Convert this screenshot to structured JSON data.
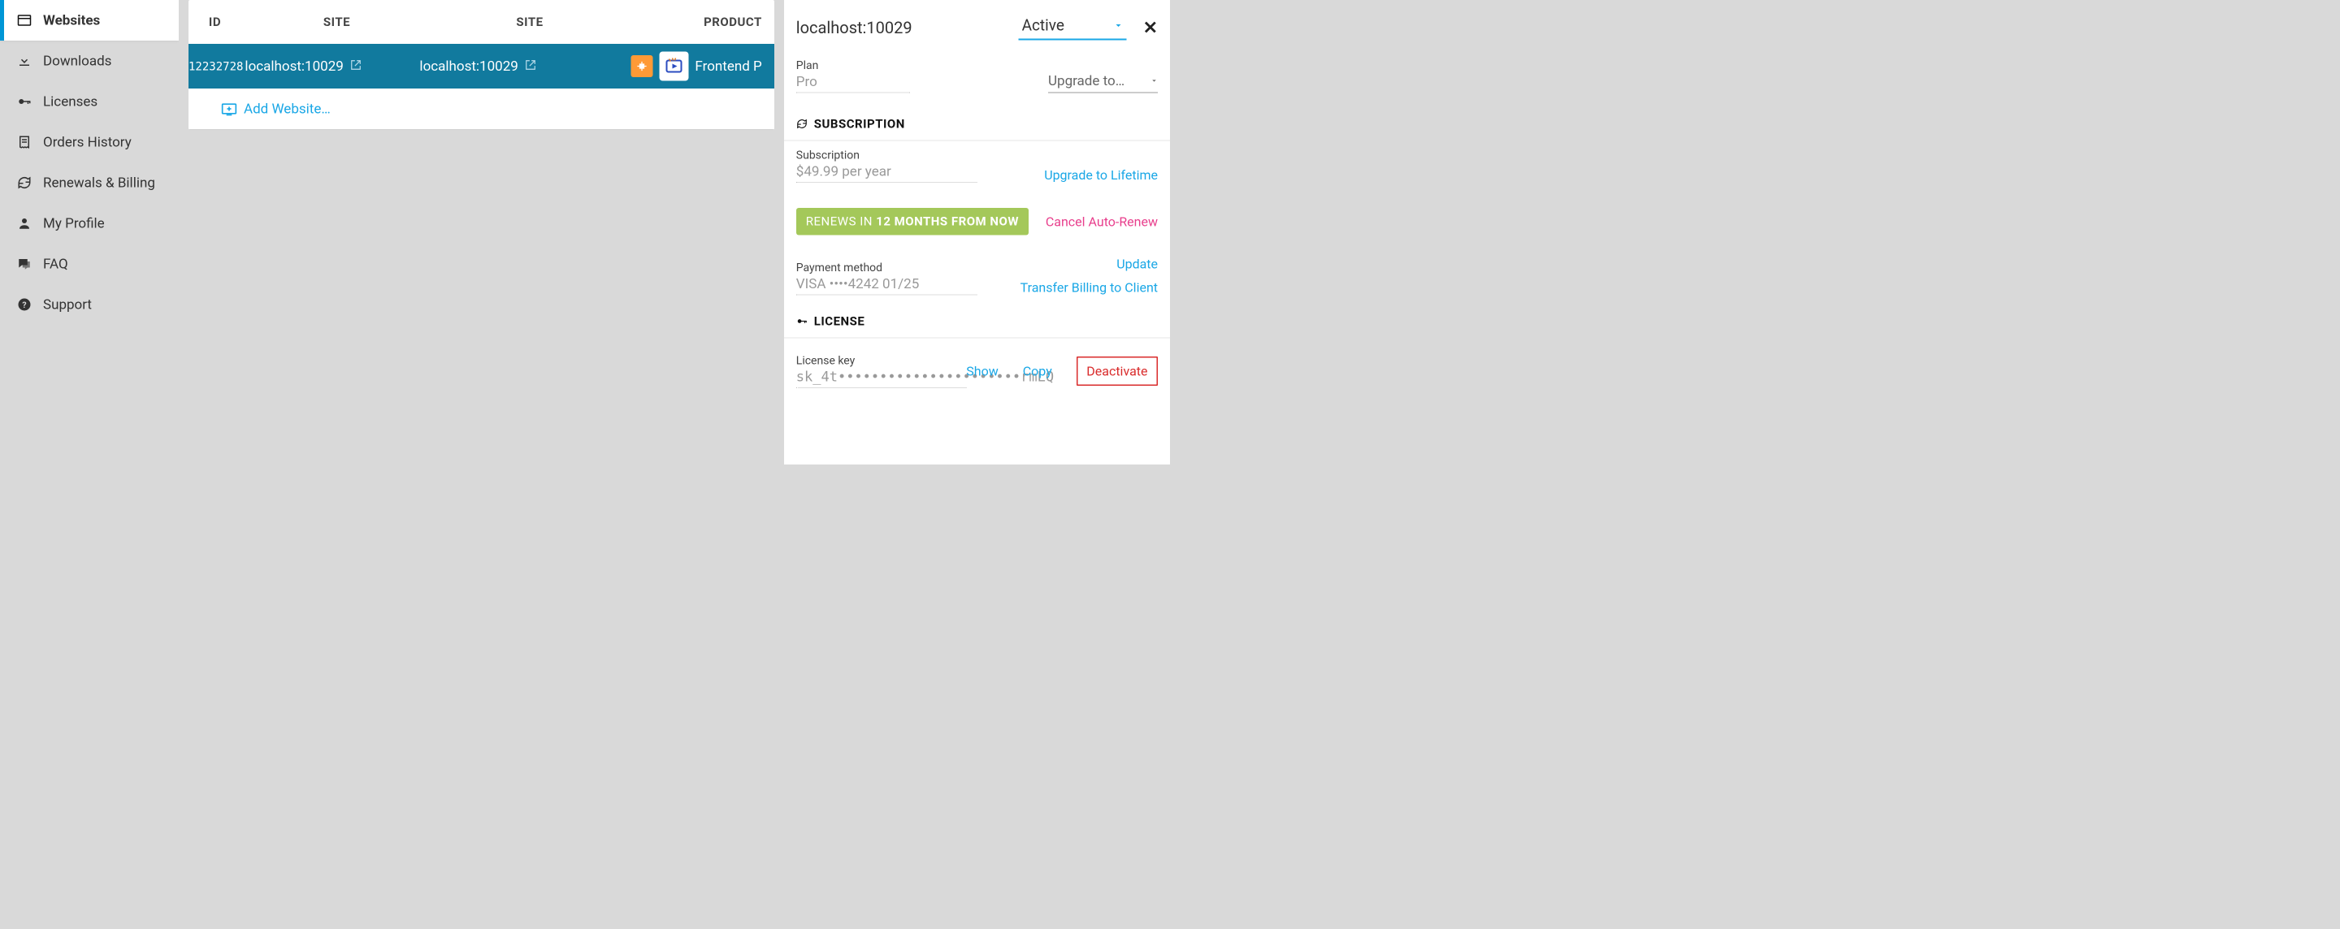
{
  "sidebar": {
    "items": [
      {
        "label": "Websites"
      },
      {
        "label": "Downloads"
      },
      {
        "label": "Licenses"
      },
      {
        "label": "Orders History"
      },
      {
        "label": "Renewals & Billing"
      },
      {
        "label": "My Profile"
      },
      {
        "label": "FAQ"
      },
      {
        "label": "Support"
      }
    ]
  },
  "table": {
    "headers": {
      "id": "ID",
      "site1": "SITE",
      "site2": "SITE",
      "product": "PRODUCT"
    },
    "row": {
      "id": "12232728",
      "site1": "localhost:10029",
      "site2": "localhost:10029",
      "product": "Frontend P"
    },
    "add": "Add Website…"
  },
  "detail": {
    "title": "localhost:10029",
    "status": "Active",
    "plan": {
      "label": "Plan",
      "value": "Pro",
      "upgrade": "Upgrade to…"
    },
    "sections": {
      "subscription": {
        "heading": "SUBSCRIPTION",
        "price_label": "Subscription",
        "price_value": "$49.99 per year",
        "upgrade_lifetime": "Upgrade to Lifetime",
        "renew_prefix": "RENEWS IN ",
        "renew_bold": "12 MONTHS FROM NOW",
        "cancel": "Cancel Auto-Renew",
        "payment_label": "Payment method",
        "payment_value": "VISA ••••4242 01/25",
        "update": "Update",
        "transfer": "Transfer Billing to Client"
      },
      "license": {
        "heading": "LICENSE",
        "key_label": "License key",
        "key_value": "sk_4t••••••••••••••••••••••rmLQ",
        "show": "Show",
        "copy": "Copy",
        "deactivate": "Deactivate"
      }
    }
  }
}
